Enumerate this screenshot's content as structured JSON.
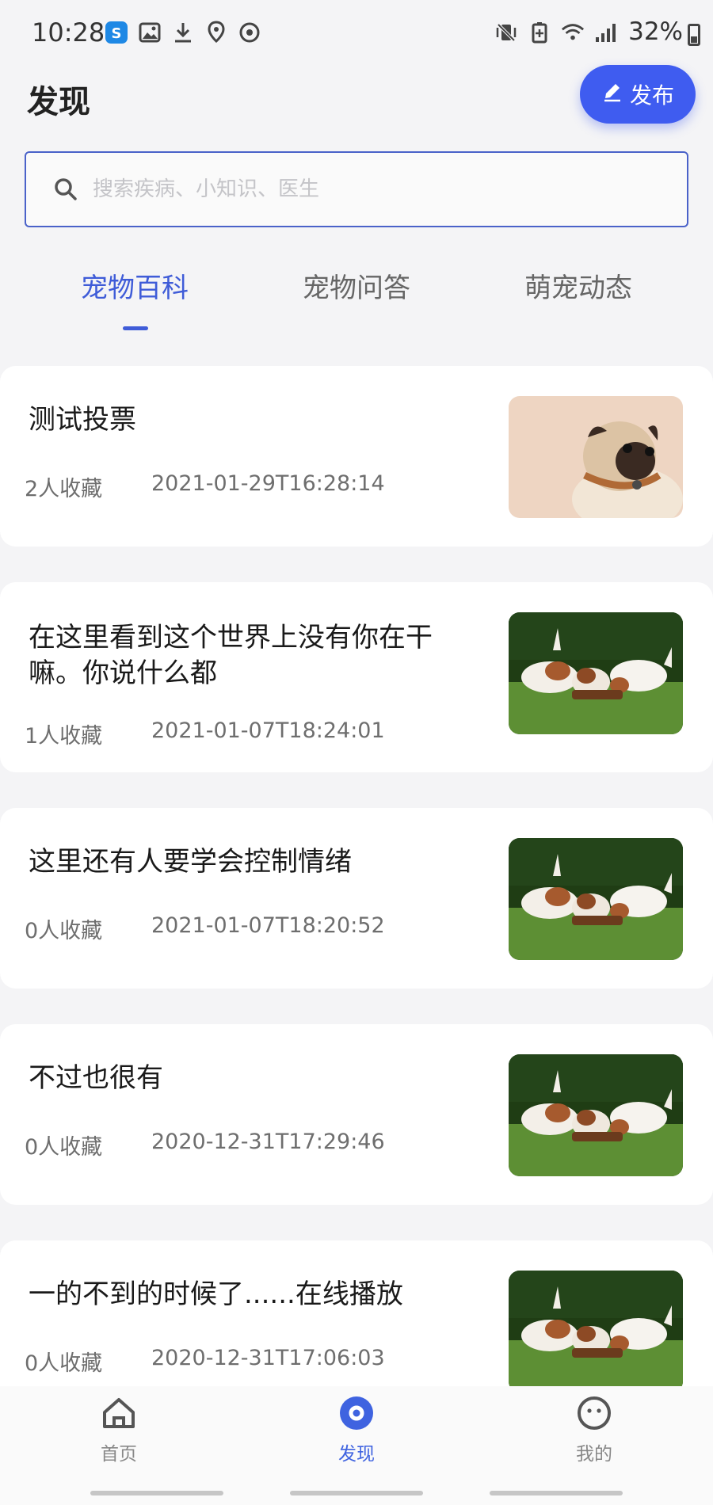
{
  "status_bar": {
    "time": "10:28",
    "battery": "32%",
    "left_icons": [
      "s-app-icon",
      "gallery-icon",
      "download-icon",
      "location-icon",
      "sync-icon"
    ],
    "right_icons": [
      "vibrate-icon",
      "battery-saver-icon",
      "wifi-icon",
      "signal-icon"
    ]
  },
  "header": {
    "title": "发现",
    "publish_label": "发布"
  },
  "search": {
    "placeholder": "搜索疾病、小知识、医生"
  },
  "tabs": [
    {
      "label": "宠物百科",
      "active": true
    },
    {
      "label": "宠物问答",
      "active": false
    },
    {
      "label": "萌宠动态",
      "active": false
    }
  ],
  "articles": [
    {
      "title": "测试投票",
      "favorites": "2人收藏",
      "date": "2021-01-29T16:28:14",
      "thumb": "pug-photo"
    },
    {
      "title": "在这里看到这个世界上没有你在干嘛。你说什么都",
      "favorites": "1人收藏",
      "date": "2021-01-07T18:24:01",
      "thumb": "puppies-photo"
    },
    {
      "title": "这里还有人要学会控制情绪",
      "favorites": "0人收藏",
      "date": "2021-01-07T18:20:52",
      "thumb": "puppies-photo"
    },
    {
      "title": "不过也很有",
      "favorites": "0人收藏",
      "date": "2020-12-31T17:29:46",
      "thumb": "puppies-photo"
    },
    {
      "title": "一的不到的时候了......在线播放",
      "favorites": "0人收藏",
      "date": "2020-12-31T17:06:03",
      "thumb": "puppies-photo"
    }
  ],
  "bottom_nav": [
    {
      "label": "首页",
      "icon": "home-icon",
      "active": false
    },
    {
      "label": "发现",
      "icon": "discover-icon",
      "active": true
    },
    {
      "label": "我的",
      "icon": "profile-icon",
      "active": false
    }
  ],
  "colors": {
    "accent": "#3f5cf0",
    "tab_active": "#3f5cd8",
    "background": "#f4f4f6"
  }
}
